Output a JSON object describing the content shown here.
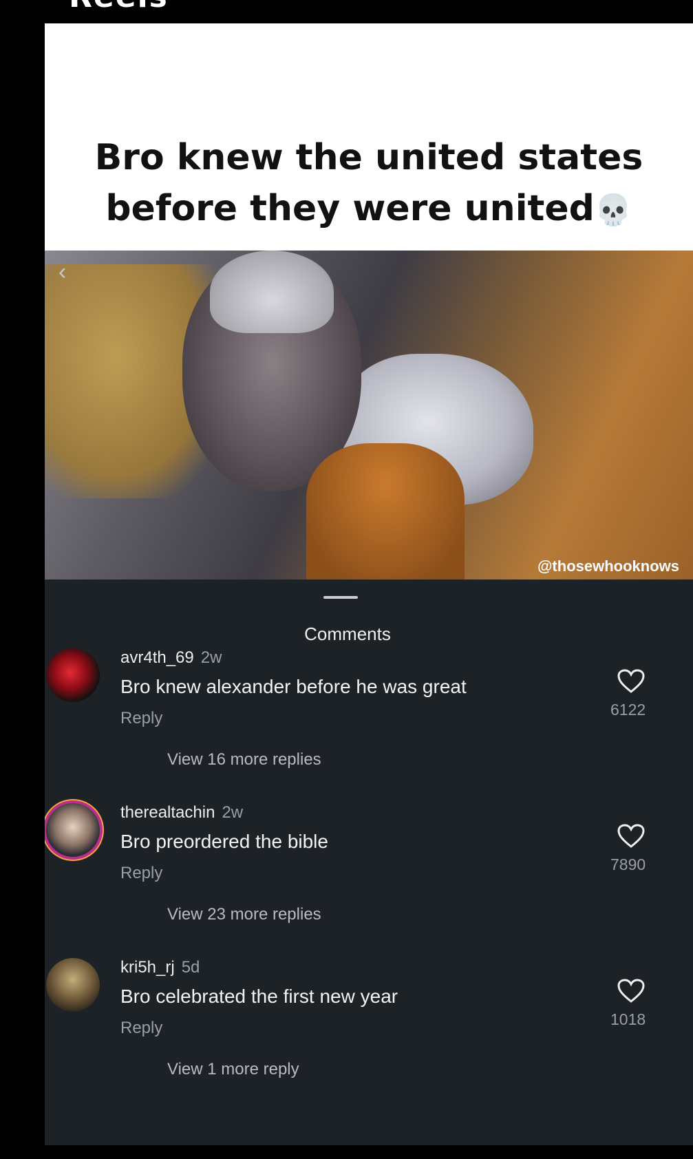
{
  "header": {
    "title": "Reels"
  },
  "post": {
    "caption": "Bro knew the united states before they were united",
    "caption_emoji": "💀",
    "watermark": "@thosewhooknows",
    "back_icon": "chevron-left-icon"
  },
  "comments_sheet": {
    "title": "Comments",
    "comments": [
      {
        "username": "avr4th_69",
        "time": "2w",
        "text": "Bro knew alexander before he was great",
        "reply_label": "Reply",
        "view_replies": "View 16 more replies",
        "likes": "6122"
      },
      {
        "username": "therealtachin",
        "time": "2w",
        "text": "Bro preordered the bible",
        "reply_label": "Reply",
        "view_replies": "View 23 more replies",
        "likes": "7890"
      },
      {
        "username": "kri5h_rj",
        "time": "5d",
        "text": "Bro celebrated the first new year",
        "reply_label": "Reply",
        "view_replies": "View 1 more reply",
        "likes": "1018"
      }
    ]
  },
  "colors": {
    "sheet_bg": "#1d2227",
    "secondary_text": "#9aa0a6"
  }
}
